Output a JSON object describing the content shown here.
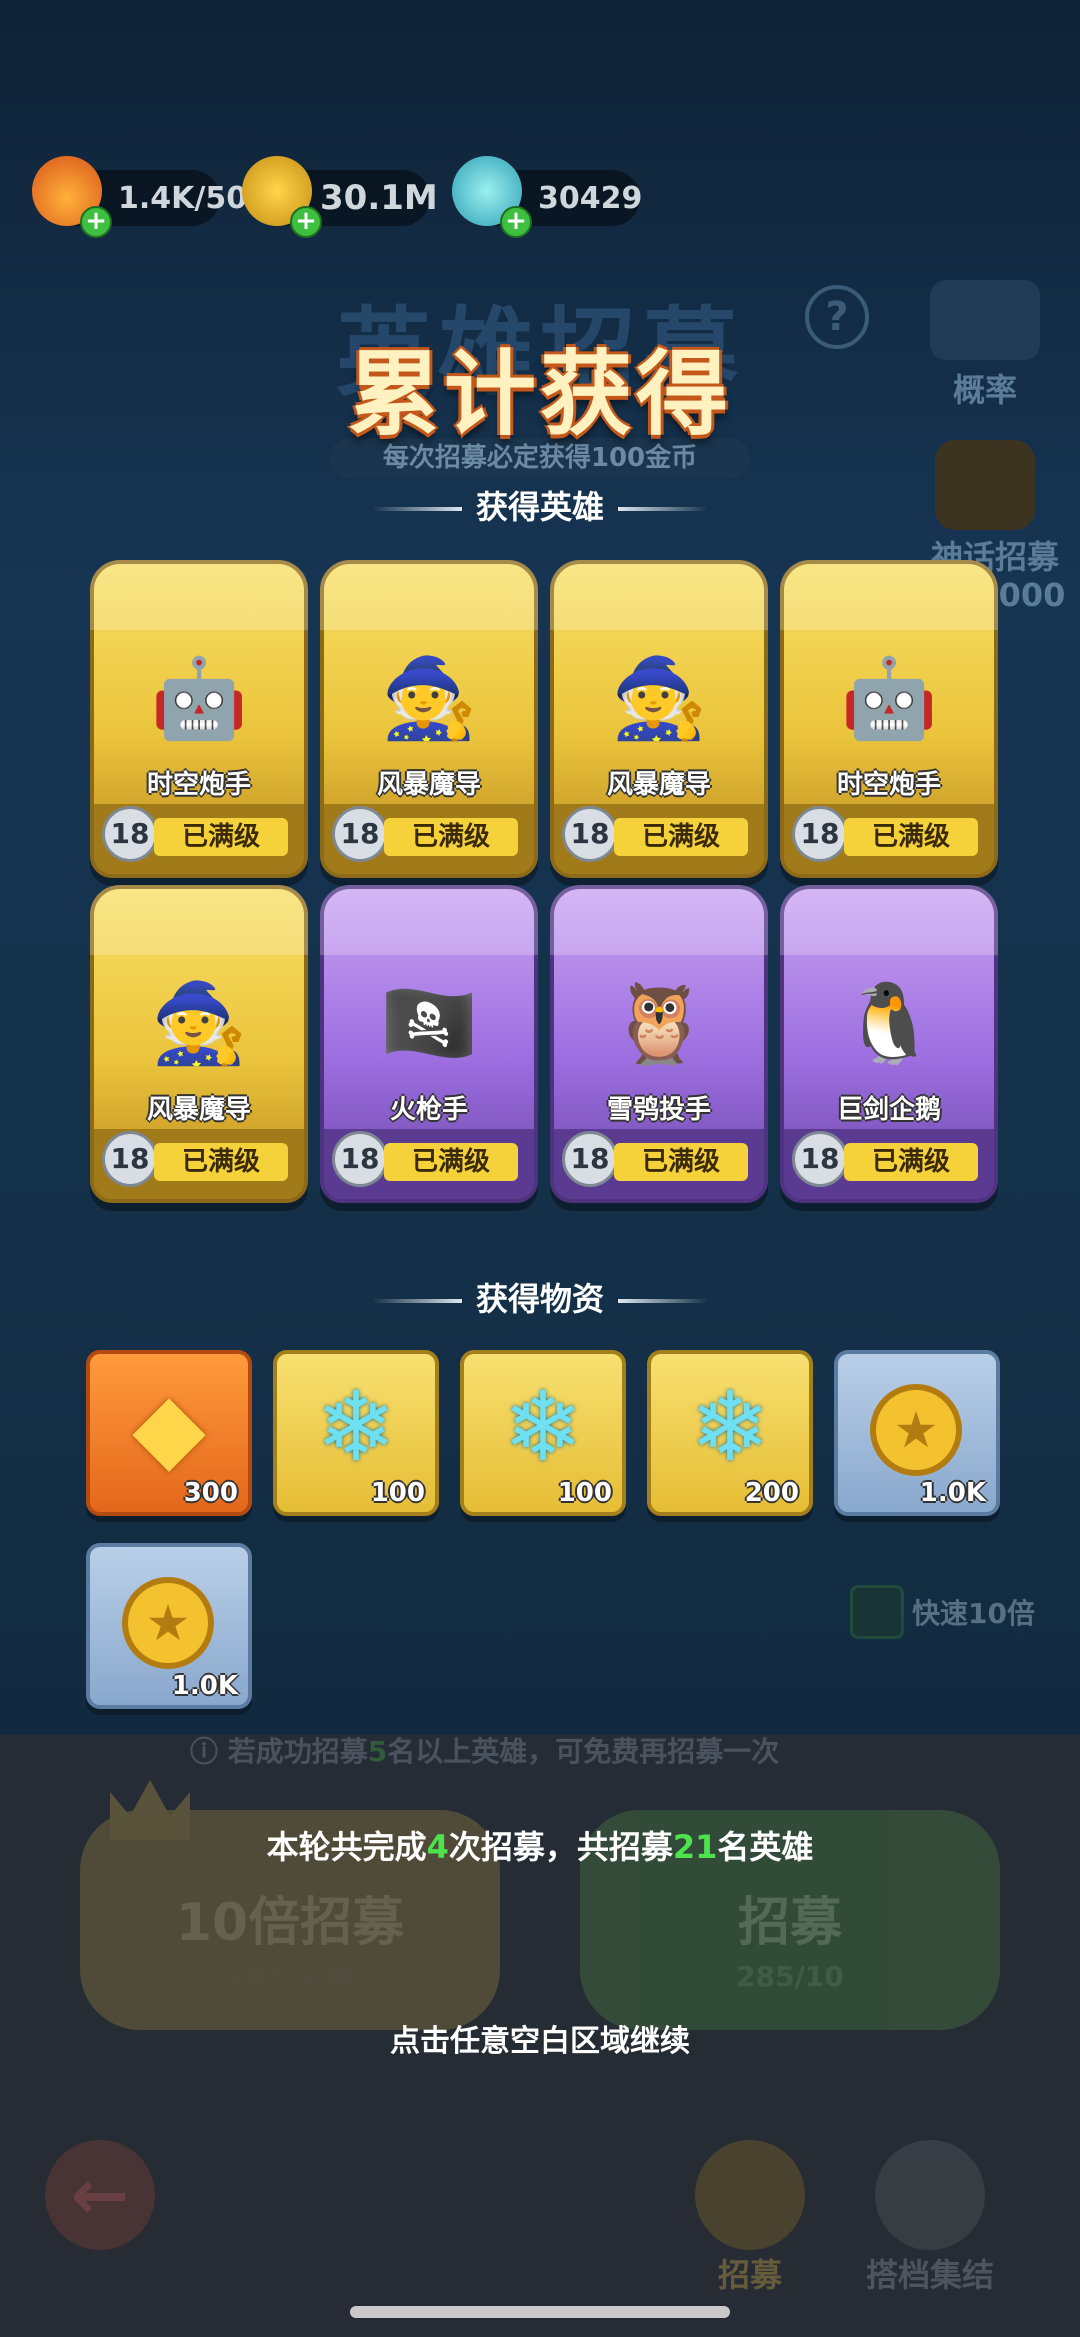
{
  "resources": [
    {
      "icon": "flame-icon",
      "value": "1.4K/50"
    },
    {
      "icon": "coin-icon",
      "value": "30.1M"
    },
    {
      "icon": "crystal-icon",
      "value": "30429"
    }
  ],
  "background": {
    "title": "英雄招募",
    "subtitle": "每次招募必定获得100金币",
    "probability_label": "概率",
    "mythic_label": "神话招募",
    "mythic_count": "/2000",
    "fast_label": "快速10倍",
    "tip_prefix": "若成功招募",
    "tip_num": "5",
    "tip_suffix": "名以上英雄，可免费再招募一次",
    "ten_recruit": "10倍招募",
    "ten_cost": "285/100",
    "recruit": "招募",
    "recruit_cost": "285/10",
    "nav_recruit": "招募",
    "nav_gather": "搭档集结"
  },
  "title": "累计获得",
  "heroes_section": "获得英雄",
  "heroes": [
    {
      "name": "时空炮手",
      "level": "18",
      "status": "已满级",
      "rarity": "gold",
      "icon": "gunner-icon"
    },
    {
      "name": "风暴魔导",
      "level": "18",
      "status": "已满级",
      "rarity": "gold",
      "icon": "wizard-icon"
    },
    {
      "name": "风暴魔导",
      "level": "18",
      "status": "已满级",
      "rarity": "gold",
      "icon": "wizard-icon"
    },
    {
      "name": "时空炮手",
      "level": "18",
      "status": "已满级",
      "rarity": "gold",
      "icon": "gunner-icon"
    },
    {
      "name": "风暴魔导",
      "level": "18",
      "status": "已满级",
      "rarity": "gold",
      "icon": "wizard-icon"
    },
    {
      "name": "火枪手",
      "level": "18",
      "status": "已满级",
      "rarity": "purple",
      "icon": "musketeer-icon"
    },
    {
      "name": "雪鸮投手",
      "level": "18",
      "status": "已满级",
      "rarity": "purple",
      "icon": "owl-icon"
    },
    {
      "name": "巨剑企鹅",
      "level": "18",
      "status": "已满级",
      "rarity": "purple",
      "icon": "penguin-icon"
    }
  ],
  "items_section": "获得物资",
  "items": [
    {
      "icon": "gold-crystal-icon",
      "qty": "300",
      "bg": "orange"
    },
    {
      "icon": "snowflake-crystal-icon",
      "qty": "100",
      "bg": "gold"
    },
    {
      "icon": "snowflake-crystal-icon",
      "qty": "100",
      "bg": "gold"
    },
    {
      "icon": "snowflake-crystal-icon",
      "qty": "200",
      "bg": "gold"
    },
    {
      "icon": "coin-icon",
      "qty": "1.0K",
      "bg": "blue"
    },
    {
      "icon": "coin-icon",
      "qty": "1.0K",
      "bg": "blue"
    }
  ],
  "summary": {
    "prefix": "本轮共完成",
    "times": "4",
    "middle": "次招募，共招募",
    "count": "21",
    "suffix": "名英雄"
  },
  "continue_text": "点击任意空白区域继续"
}
